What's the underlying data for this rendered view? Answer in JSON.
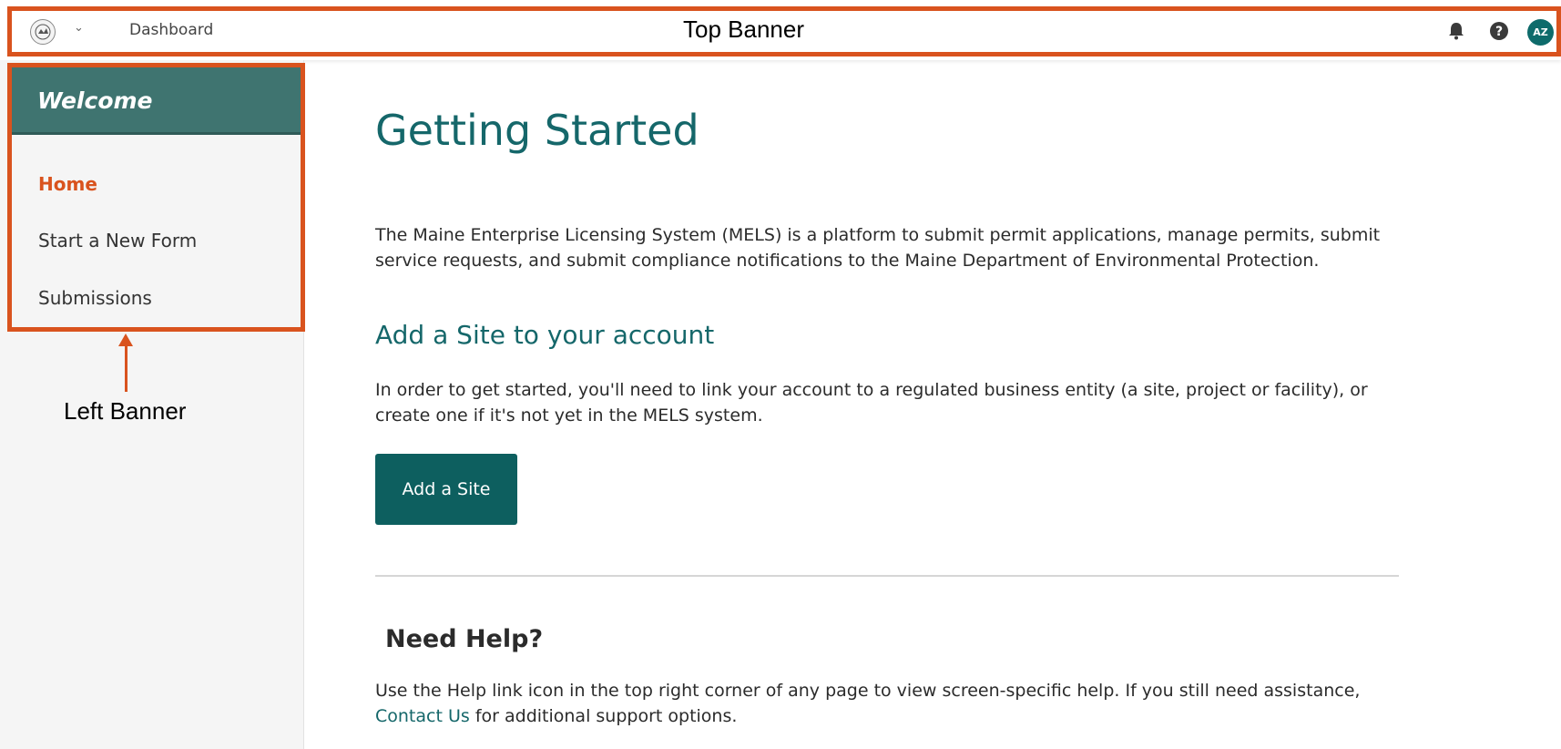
{
  "topbar": {
    "breadcrumb": "Dashboard",
    "annotation_label": "Top Banner",
    "avatar_initials": "AZ",
    "icons": [
      "logo-seal-icon",
      "chevron-down-icon",
      "bell-icon",
      "help-icon"
    ]
  },
  "sidebar": {
    "welcome": "Welcome",
    "items": [
      {
        "label": "Home",
        "active": true
      },
      {
        "label": "Start a New Form",
        "active": false
      },
      {
        "label": "Submissions",
        "active": false
      }
    ],
    "annotation_label": "Left Banner"
  },
  "main": {
    "title": "Getting Started",
    "intro": "The Maine Enterprise Licensing System (MELS) is a platform to submit permit applications, manage permits, submit service requests, and submit compliance notifications to the Maine Department of Environmental Protection.",
    "site_heading": "Add a Site to your account",
    "site_text": "In order to get started, you'll need to link your account to a regulated business entity (a site, project or facility), or create one if it's not yet in the MELS system.",
    "add_site_button": "Add a Site",
    "help_heading": "Need Help?",
    "help_text_before": "Use the Help link icon in the top right corner of any page to view screen-specific help. If you still need assistance,",
    "help_link": "Contact Us",
    "help_text_after": "for additional support options."
  },
  "colors": {
    "accent": "#d9531e",
    "brand_teal": "#15676a",
    "welcome_bg": "#3f7470",
    "button_bg": "#0d5f5f"
  }
}
